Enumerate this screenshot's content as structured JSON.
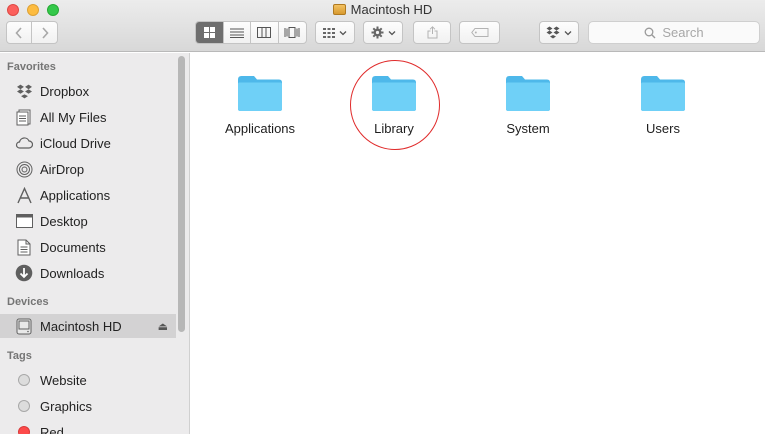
{
  "window": {
    "title": "Macintosh HD",
    "title_icon": "disk-icon"
  },
  "toolbar": {
    "back_icon": "chevron-left-icon",
    "forward_icon": "chevron-right-icon",
    "view_modes": [
      "icon-view",
      "list-view",
      "column-view",
      "cover-flow-view"
    ],
    "active_view": "icon-view",
    "search_placeholder": "Search"
  },
  "sidebar": {
    "favorites_heading": "Favorites",
    "favorites": [
      {
        "label": "Dropbox",
        "icon": "dropbox-icon"
      },
      {
        "label": "All My Files",
        "icon": "all-my-files-icon"
      },
      {
        "label": "iCloud Drive",
        "icon": "cloud-icon"
      },
      {
        "label": "AirDrop",
        "icon": "airdrop-icon"
      },
      {
        "label": "Applications",
        "icon": "applications-icon"
      },
      {
        "label": "Desktop",
        "icon": "desktop-icon"
      },
      {
        "label": "Documents",
        "icon": "documents-icon"
      },
      {
        "label": "Downloads",
        "icon": "downloads-icon"
      }
    ],
    "devices_heading": "Devices",
    "devices": [
      {
        "label": "Macintosh HD",
        "icon": "hard-drive-icon",
        "selected": true,
        "eject": "⏏"
      }
    ],
    "tags_heading": "Tags",
    "tags": [
      {
        "label": "Website",
        "color": "#dcdcdc"
      },
      {
        "label": "Graphics",
        "color": "#dcdcdc"
      },
      {
        "label": "Red",
        "color": "#fd4a4a"
      }
    ]
  },
  "content": {
    "folders": [
      {
        "label": "Applications",
        "icon": "folder-icon"
      },
      {
        "label": "Library",
        "icon": "folder-icon",
        "highlighted": true
      },
      {
        "label": "System",
        "icon": "folder-icon"
      },
      {
        "label": "Users",
        "icon": "folder-icon"
      }
    ],
    "highlight_color": "#e02b2b",
    "folder_color": "#5ec8f4"
  }
}
